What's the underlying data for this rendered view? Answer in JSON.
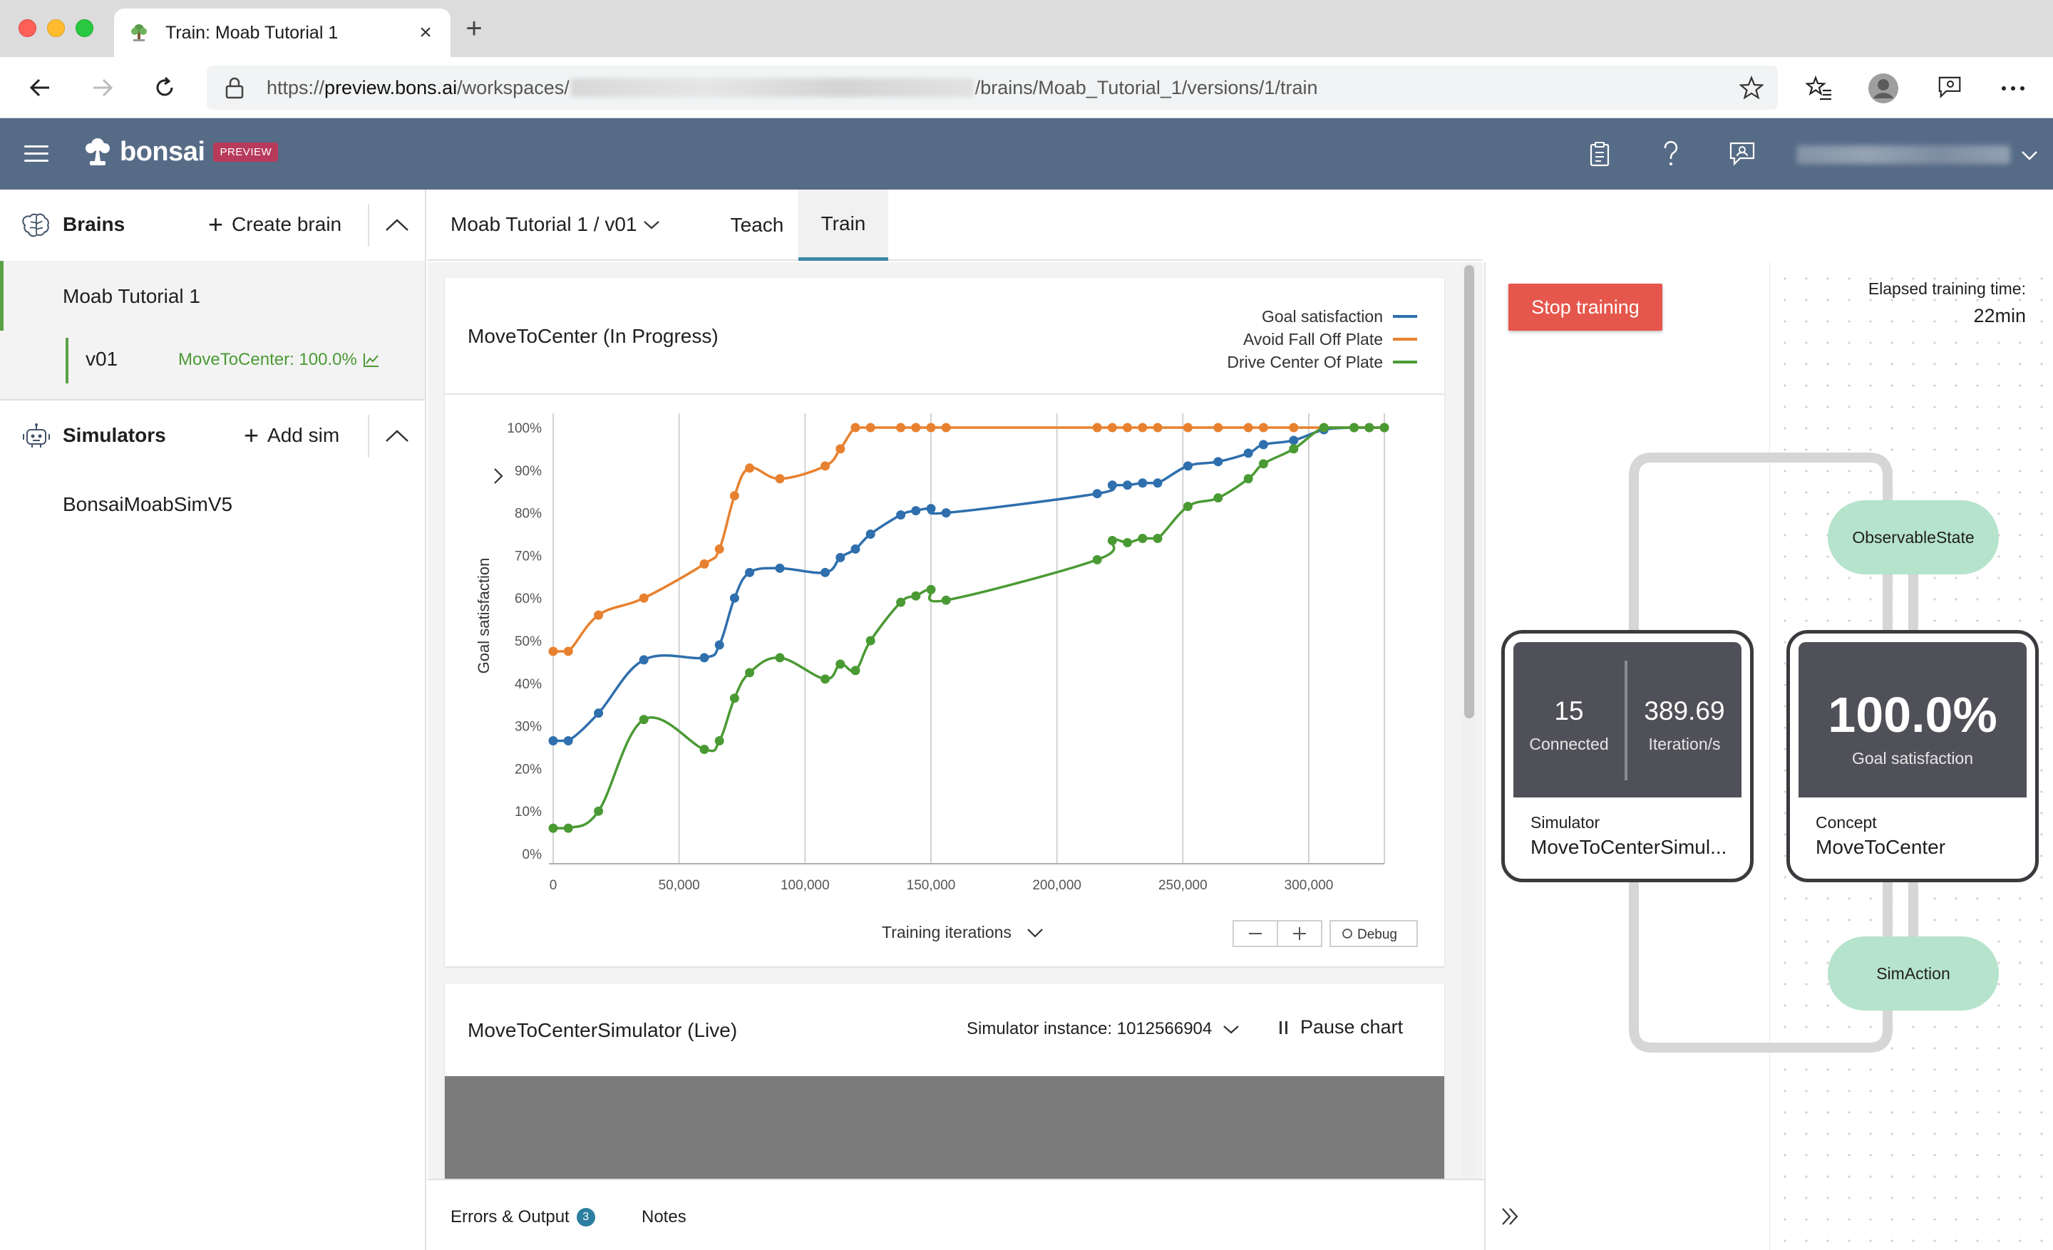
{
  "browser": {
    "tab_title": "Train: Moab Tutorial 1",
    "url_prefix": "https://",
    "url_host": "preview.bons.ai",
    "url_path_start": "/workspaces/",
    "url_path_end": "/brains/Moab_Tutorial_1/versions/1/train"
  },
  "header": {
    "logo_text": "bonsai",
    "badge": "PREVIEW"
  },
  "sidebar": {
    "brains_title": "Brains",
    "create_brain": "Create brain",
    "brain_name": "Moab Tutorial 1",
    "version": "v01",
    "version_status": "MoveToCenter: 100.0%",
    "simulators_title": "Simulators",
    "add_sim": "Add sim",
    "simulator_name": "BonsaiMoabSimV5"
  },
  "main": {
    "version_select": "Moab Tutorial 1 / v01",
    "tabs": [
      {
        "label": "Teach"
      },
      {
        "label": "Train"
      }
    ],
    "chart_card_title": "MoveToCenter (In Progress)",
    "x_axis_label": "Training iterations",
    "debug_label": "Debug",
    "sim_card_title": "MoveToCenterSimulator (Live)",
    "sim_instance": "Simulator instance: 1012566904",
    "pause_chart": "Pause chart"
  },
  "bottom": {
    "errors_label": "Errors & Output",
    "errors_count": "3",
    "notes_label": "Notes"
  },
  "right": {
    "stop_training": "Stop training",
    "elapsed_label": "Elapsed training time:",
    "elapsed_value": "22min",
    "observable_state": "ObservableState",
    "sim_action": "SimAction",
    "connected_value": "15",
    "connected_label": "Connected",
    "iter_value": "389.69",
    "iter_label": "Iteration/s",
    "simulator_label": "Simulator",
    "simulator_name": "MoveToCenterSimul...",
    "goal_value": "100.0%",
    "goal_label": "Goal satisfaction",
    "concept_label": "Concept",
    "concept_name": "MoveToCenter"
  },
  "colors": {
    "header": "#566b86",
    "goal": "#2f6fad",
    "avoid": "#e8812f",
    "drive": "#4a9a34",
    "stop": "#e5574c",
    "pill": "#b6e3cb"
  },
  "chart_data": {
    "type": "line",
    "ylabel": "Goal satisfaction",
    "xlabel": "Training iterations",
    "xlim": [
      0,
      330000
    ],
    "ylim": [
      0,
      100
    ],
    "x_ticks": [
      "0",
      "50,000",
      "100,000",
      "150,000",
      "200,000",
      "250,000",
      "300,000"
    ],
    "y_ticks": [
      "0%",
      "10%",
      "20%",
      "30%",
      "40%",
      "50%",
      "60%",
      "70%",
      "80%",
      "90%",
      "100%"
    ],
    "grid": "vertical",
    "legend_position": "top-right",
    "series": [
      {
        "name": "Goal satisfaction",
        "color": "#2f6fad",
        "points": [
          [
            0,
            26.5
          ],
          [
            6000,
            26.5
          ],
          [
            18000,
            33
          ],
          [
            36000,
            45.5
          ],
          [
            60000,
            46
          ],
          [
            66000,
            49
          ],
          [
            72000,
            60
          ],
          [
            78000,
            66
          ],
          [
            90000,
            67
          ],
          [
            108000,
            66
          ],
          [
            114000,
            69.5
          ],
          [
            120000,
            71.5
          ],
          [
            126000,
            75
          ],
          [
            138000,
            79.5
          ],
          [
            144000,
            80.5
          ],
          [
            150000,
            81
          ],
          [
            156000,
            80
          ],
          [
            216000,
            84.5
          ],
          [
            222000,
            86.5
          ],
          [
            228000,
            86.5
          ],
          [
            234000,
            87
          ],
          [
            240000,
            87
          ],
          [
            252000,
            91
          ],
          [
            264000,
            92
          ],
          [
            276000,
            94
          ],
          [
            282000,
            96
          ],
          [
            294000,
            97
          ],
          [
            306000,
            99.5
          ],
          [
            318000,
            100
          ],
          [
            324000,
            100
          ],
          [
            330000,
            100
          ]
        ]
      },
      {
        "name": "Avoid Fall Off Plate",
        "color": "#e8812f",
        "points": [
          [
            0,
            47.5
          ],
          [
            6000,
            47.5
          ],
          [
            18000,
            56
          ],
          [
            36000,
            60
          ],
          [
            60000,
            68
          ],
          [
            66000,
            71.5
          ],
          [
            72000,
            84
          ],
          [
            78000,
            90.5
          ],
          [
            90000,
            88
          ],
          [
            108000,
            91
          ],
          [
            114000,
            95
          ],
          [
            120000,
            100
          ],
          [
            126000,
            100
          ],
          [
            138000,
            100
          ],
          [
            144000,
            100
          ],
          [
            150000,
            100
          ],
          [
            156000,
            100
          ],
          [
            216000,
            100
          ],
          [
            222000,
            100
          ],
          [
            228000,
            100
          ],
          [
            234000,
            100
          ],
          [
            240000,
            100
          ],
          [
            252000,
            100
          ],
          [
            264000,
            100
          ],
          [
            276000,
            100
          ],
          [
            282000,
            100
          ],
          [
            294000,
            100
          ],
          [
            306000,
            100
          ],
          [
            318000,
            100
          ],
          [
            324000,
            100
          ],
          [
            330000,
            100
          ]
        ]
      },
      {
        "name": "Drive Center Of Plate",
        "color": "#4a9a34",
        "points": [
          [
            0,
            6
          ],
          [
            6000,
            6
          ],
          [
            18000,
            10
          ],
          [
            36000,
            31.5
          ],
          [
            60000,
            24.5
          ],
          [
            66000,
            26.5
          ],
          [
            72000,
            36.5
          ],
          [
            78000,
            42.5
          ],
          [
            90000,
            46
          ],
          [
            108000,
            41
          ],
          [
            114000,
            44.5
          ],
          [
            120000,
            43
          ],
          [
            126000,
            50
          ],
          [
            138000,
            59
          ],
          [
            144000,
            60.5
          ],
          [
            150000,
            62
          ],
          [
            156000,
            59.5
          ],
          [
            216000,
            69
          ],
          [
            222000,
            73.5
          ],
          [
            228000,
            73
          ],
          [
            234000,
            74
          ],
          [
            240000,
            74
          ],
          [
            252000,
            81.5
          ],
          [
            264000,
            83.5
          ],
          [
            276000,
            88
          ],
          [
            282000,
            91.5
          ],
          [
            294000,
            95
          ],
          [
            306000,
            100
          ],
          [
            318000,
            100
          ],
          [
            324000,
            100
          ],
          [
            330000,
            100
          ]
        ]
      }
    ]
  }
}
